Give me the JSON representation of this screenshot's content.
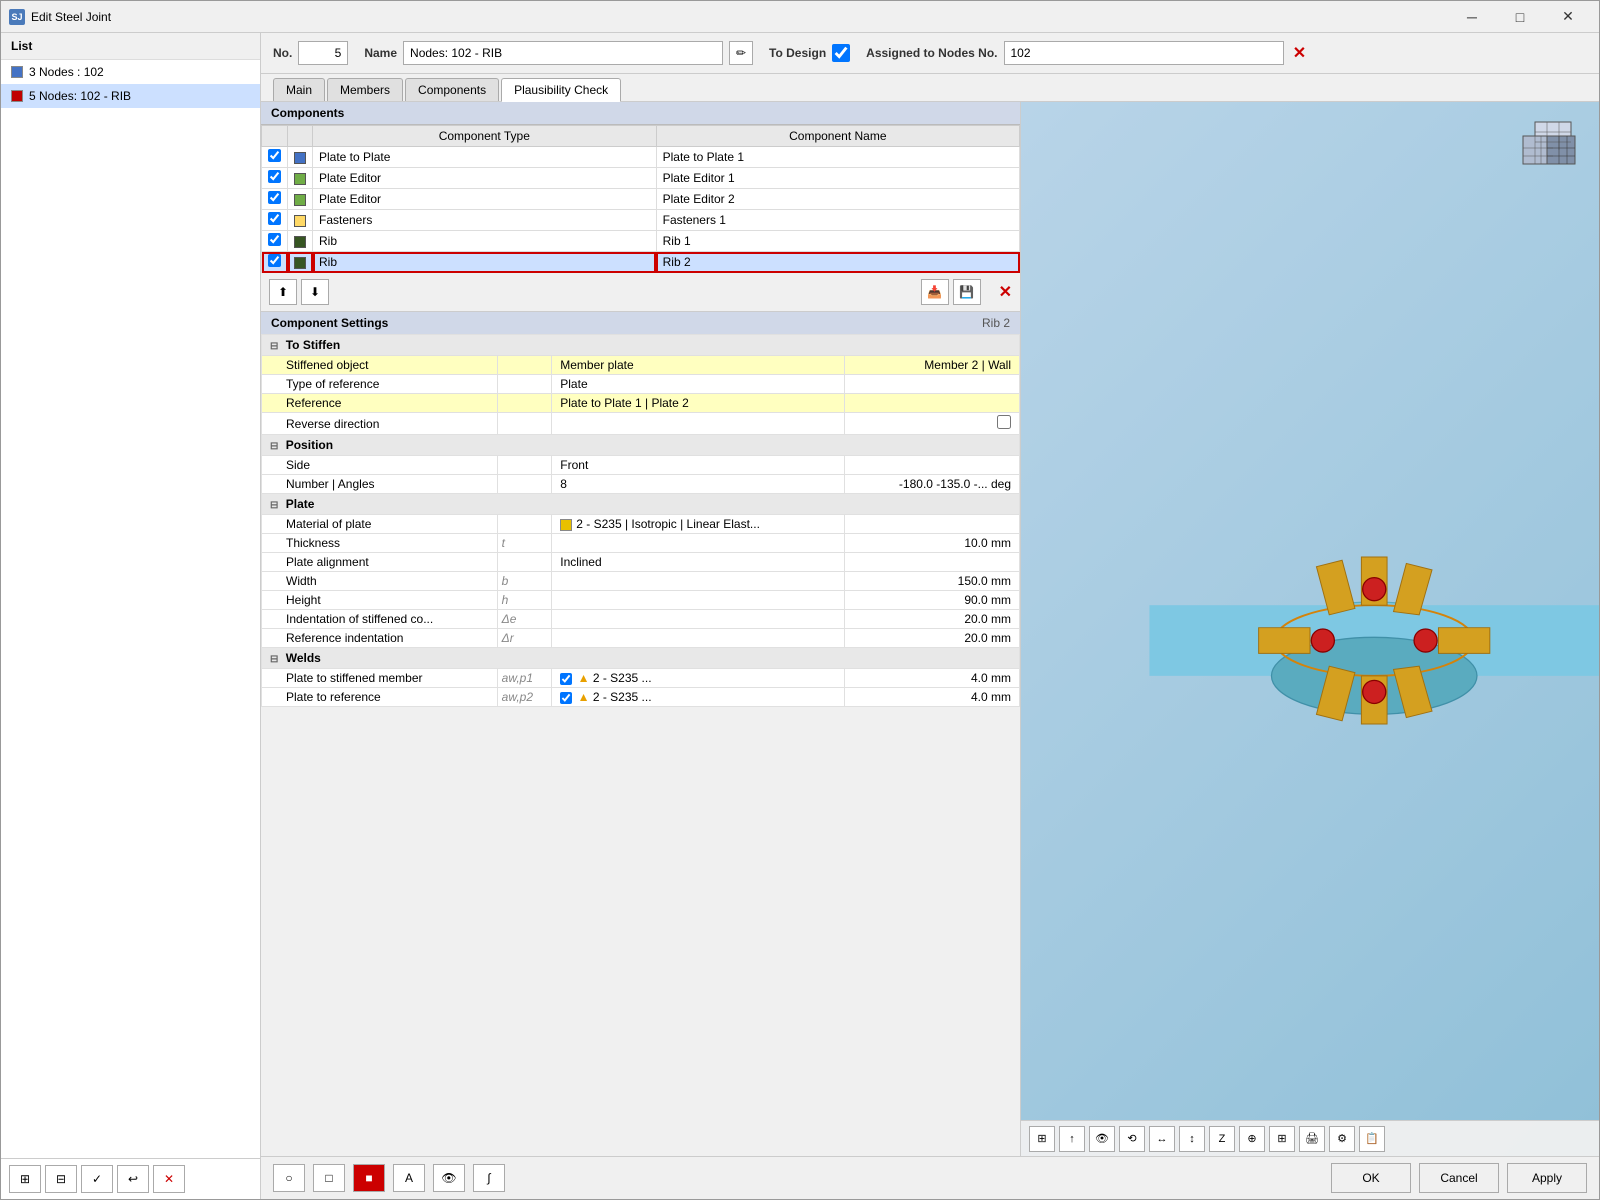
{
  "window": {
    "title": "Edit Steel Joint",
    "icon": "SJ"
  },
  "titlebar": {
    "minimize": "─",
    "maximize": "□",
    "close": "✕"
  },
  "left_panel": {
    "header": "List",
    "items": [
      {
        "id": 1,
        "color": "#4472c4",
        "label": "3 Nodes : 102",
        "selected": false
      },
      {
        "id": 2,
        "color": "#c00000",
        "label": "5 Nodes: 102 - RIB",
        "selected": true
      }
    ]
  },
  "top_form": {
    "no_label": "No.",
    "no_value": "5",
    "name_label": "Name",
    "name_value": "Nodes: 102 - RIB",
    "to_design_label": "To Design",
    "assigned_label": "Assigned to Nodes No.",
    "assigned_value": "102"
  },
  "tabs": [
    {
      "id": "main",
      "label": "Main"
    },
    {
      "id": "members",
      "label": "Members"
    },
    {
      "id": "components",
      "label": "Components"
    },
    {
      "id": "plausibility",
      "label": "Plausibility Check",
      "active": true
    }
  ],
  "components_section": {
    "header": "Components",
    "col_type": "Component Type",
    "col_name": "Component Name",
    "rows": [
      {
        "checked": true,
        "color": "#4472c4",
        "type": "Plate to Plate",
        "name": "Plate to Plate 1",
        "selected": false
      },
      {
        "checked": true,
        "color": "#70ad47",
        "type": "Plate Editor",
        "name": "Plate Editor 1",
        "selected": false
      },
      {
        "checked": true,
        "color": "#70ad47",
        "type": "Plate Editor",
        "name": "Plate Editor 2",
        "selected": false
      },
      {
        "checked": true,
        "color": "#ffd966",
        "type": "Fasteners",
        "name": "Fasteners 1",
        "selected": false
      },
      {
        "checked": true,
        "color": "#375623",
        "type": "Rib",
        "name": "Rib 1",
        "selected": false
      },
      {
        "checked": true,
        "color": "#375623",
        "type": "Rib",
        "name": "Rib 2",
        "selected": true
      }
    ]
  },
  "settings": {
    "header": "Component Settings",
    "subtitle": "Rib 2",
    "groups": [
      {
        "label": "To Stiffen",
        "expanded": true,
        "rows": [
          {
            "highlight": true,
            "label": "Stiffened object",
            "sym": "",
            "val1": "Member plate",
            "val2": "Member 2 | Wall"
          },
          {
            "highlight": false,
            "label": "Type of reference",
            "sym": "",
            "val1": "Plate",
            "val2": ""
          },
          {
            "highlight": true,
            "label": "Reference",
            "sym": "",
            "val1": "Plate to Plate 1 | Plate  2",
            "val2": ""
          },
          {
            "highlight": false,
            "label": "Reverse direction",
            "sym": "",
            "val1": "",
            "val2": "",
            "checkbox": true
          }
        ]
      },
      {
        "label": "Position",
        "expanded": true,
        "rows": [
          {
            "highlight": false,
            "label": "Side",
            "sym": "",
            "val1": "Front",
            "val2": ""
          },
          {
            "highlight": false,
            "label": "Number | Angles",
            "sym": "",
            "val1": "8",
            "val2": "-180.0  -135.0 -...",
            "unit": "deg"
          }
        ]
      },
      {
        "label": "Plate",
        "expanded": true,
        "rows": [
          {
            "highlight": false,
            "label": "Material of plate",
            "sym": "",
            "val1": "2 - S235 | Isotropic | Linear Elast...",
            "val2": "",
            "material": true
          },
          {
            "highlight": false,
            "label": "Thickness",
            "sym": "t",
            "val1": "",
            "val2": "10.0  mm"
          },
          {
            "highlight": false,
            "label": "Plate alignment",
            "sym": "",
            "val1": "Inclined",
            "val2": ""
          },
          {
            "highlight": false,
            "label": "Width",
            "sym": "b",
            "val1": "",
            "val2": "150.0  mm"
          },
          {
            "highlight": false,
            "label": "Height",
            "sym": "h",
            "val1": "",
            "val2": "90.0  mm"
          },
          {
            "highlight": false,
            "label": "Indentation of stiffened co...",
            "sym": "Δe",
            "val1": "",
            "val2": "20.0  mm"
          },
          {
            "highlight": false,
            "label": "Reference indentation",
            "sym": "Δr",
            "val1": "",
            "val2": "20.0  mm"
          }
        ]
      },
      {
        "label": "Welds",
        "expanded": true,
        "rows": [
          {
            "highlight": false,
            "label": "Plate to stiffened member",
            "sym": "aw,p1",
            "val1": "2 - S235 ...",
            "val2": "4.0  mm",
            "weld": true
          },
          {
            "highlight": false,
            "label": "Plate to reference",
            "sym": "aw,p2",
            "val1": "2 - S235 ...",
            "val2": "4.0  mm",
            "weld": true
          }
        ]
      }
    ]
  },
  "bottom_tools": {
    "tools": [
      "⊞",
      "⊟",
      "✓✓",
      "↩",
      "✕"
    ],
    "left_icons": [
      "○",
      "□",
      "■",
      "A",
      "∫"
    ]
  },
  "buttons": {
    "ok": "OK",
    "cancel": "Cancel",
    "apply": "Apply"
  }
}
